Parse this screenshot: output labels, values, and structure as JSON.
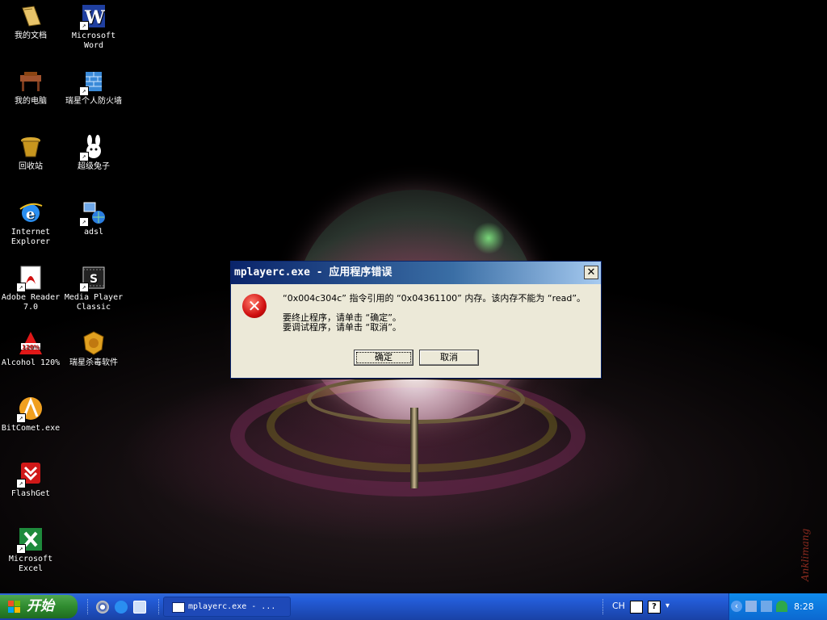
{
  "desktop": {
    "icons": [
      {
        "label": "我的文档"
      },
      {
        "label": "Microsoft Word"
      },
      {
        "label": "我的电脑"
      },
      {
        "label": "瑞星个人防火墙"
      },
      {
        "label": "回收站"
      },
      {
        "label": "超级兔子"
      },
      {
        "label": "Internet Explorer"
      },
      {
        "label": "adsl"
      },
      {
        "label": "Adobe Reader 7.0"
      },
      {
        "label": "Media Player Classic"
      },
      {
        "label": "Alcohol 120%"
      },
      {
        "label": "瑞星杀毒软件"
      },
      {
        "label": "BitComet.exe"
      },
      {
        "label": "FlashGet"
      },
      {
        "label": "Microsoft Excel"
      }
    ],
    "signature": "Anklimang"
  },
  "dialog": {
    "title": "mplayerc.exe - 应用程序错误",
    "close_glyph": "✕",
    "error_glyph": "✕",
    "line1": "“0x004c304c” 指令引用的 “0x04361100” 内存。该内存不能为 “read”。",
    "line2": "要终止程序，请单击 “确定”。",
    "line3": "要调试程序，请单击 “取消”。",
    "ok_label": "确定",
    "cancel_label": "取消"
  },
  "taskbar": {
    "start_label": "开始",
    "window_button": "mplayerc.exe - ...",
    "lang": "CH",
    "clock": "8:28"
  }
}
